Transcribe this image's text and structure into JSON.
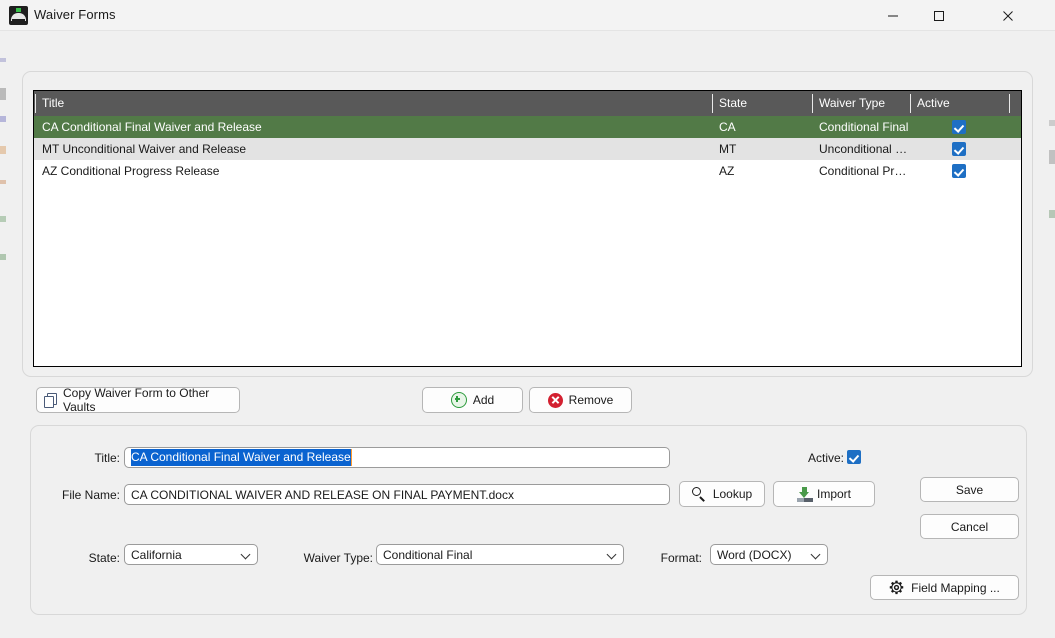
{
  "window": {
    "title": "Waiver Forms",
    "icon": "app-icon",
    "controls": {
      "minimize": "minimize-icon",
      "maximize": "maximize-icon",
      "close": "close-icon"
    }
  },
  "grid": {
    "columns": [
      "Title",
      "State",
      "Waiver Type",
      "Active"
    ],
    "rows": [
      {
        "title": "CA Conditional Final Waiver and Release",
        "state": "CA",
        "waiver_type": "Conditional Final",
        "active": true,
        "selected": true
      },
      {
        "title": "MT Unconditional Waiver and Release",
        "state": "MT",
        "waiver_type": "Unconditional Final",
        "active": true,
        "selected": false
      },
      {
        "title": "AZ Conditional Progress Release",
        "state": "AZ",
        "waiver_type": "Conditional Progr...",
        "active": true,
        "selected": false
      }
    ]
  },
  "actions": {
    "copy_label": "Copy Waiver Form to Other Vaults",
    "add_label": "Add",
    "remove_label": "Remove"
  },
  "detail": {
    "title_label": "Title:",
    "title_value": "CA Conditional Final Waiver and Release",
    "file_label": "File Name:",
    "file_value": "CA CONDITIONAL WAIVER AND RELEASE ON FINAL PAYMENT.docx",
    "lookup_label": "Lookup",
    "import_label": "Import",
    "active_label": "Active:",
    "active_checked": true,
    "save_label": "Save",
    "cancel_label": "Cancel",
    "state_label": "State:",
    "state_value": "California",
    "waiver_type_label": "Waiver Type:",
    "waiver_type_value": "Conditional Final",
    "format_label": "Format:",
    "format_value": "Word (DOCX)",
    "field_mapping_label": "Field Mapping ..."
  },
  "colors": {
    "selection_green": "#527a47",
    "header_gray": "#595959",
    "checkbox_blue": "#1e6fc4",
    "text_selection_blue": "#0a63d0",
    "add_green": "#2e9b3e",
    "remove_red": "#d32030"
  }
}
